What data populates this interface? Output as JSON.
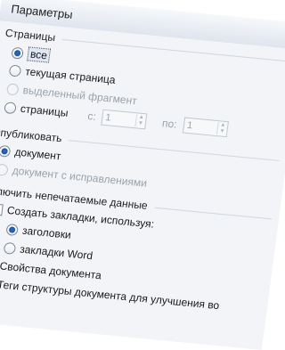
{
  "window": {
    "title": "Параметры"
  },
  "pages": {
    "title": "Страницы",
    "all": "все",
    "current": "текущая страница",
    "selection": "выделенный фрагмент",
    "range": "страницы",
    "from_label": "с:",
    "from_value": "1",
    "to_label": "по:",
    "to_value": "1"
  },
  "publish": {
    "title": "Опубликовать",
    "document": "документ",
    "document_markup": "документ с исправлениями"
  },
  "nonprint": {
    "title": "Включить непечатаемые данные",
    "bookmarks": "Создать закладки, используя:",
    "headings": "заголовки",
    "word_bookmarks": "закладки Word",
    "properties": "Свойства документа",
    "structure_tags": "Теги структуры документа для улучшения во"
  },
  "colors": {
    "accent": "#2a71cc",
    "background": "#f2f4f7",
    "title_bar": "#e6ebf2"
  }
}
